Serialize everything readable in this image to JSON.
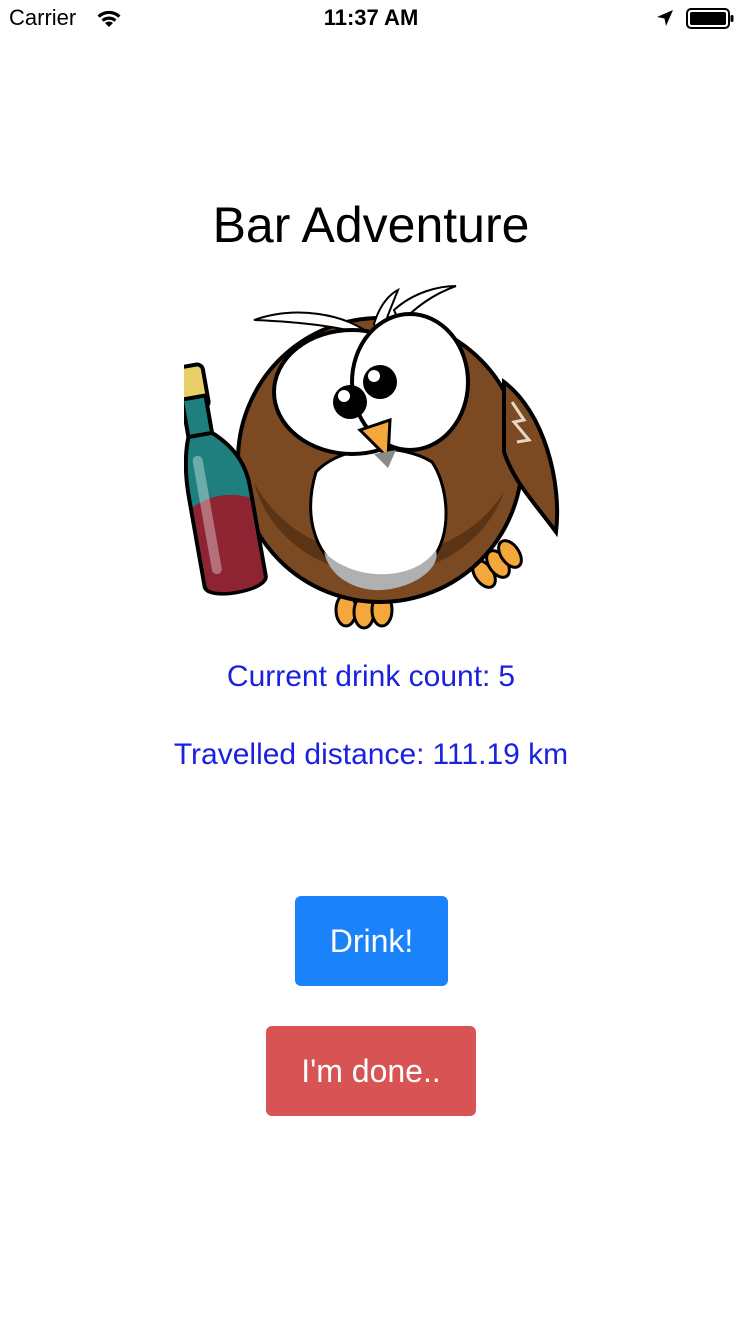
{
  "status_bar": {
    "carrier": "Carrier",
    "time": "11:37 AM",
    "icons": [
      "wifi-icon",
      "location-arrow-icon",
      "battery-icon"
    ]
  },
  "app": {
    "title": "Bar Adventure",
    "mascot_image": "drunk-owl-with-bottle"
  },
  "stats": {
    "drink_label": "Current drink count:",
    "drink_value": "5",
    "distance_label": "Travelled distance:",
    "distance_value": "111.19 km"
  },
  "actions": {
    "drink_label": "Drink!",
    "done_label": "I'm done.."
  },
  "colors": {
    "stat_text": "#1a22e0",
    "drink_button": "#1a83fb",
    "done_button": "#d85454"
  }
}
